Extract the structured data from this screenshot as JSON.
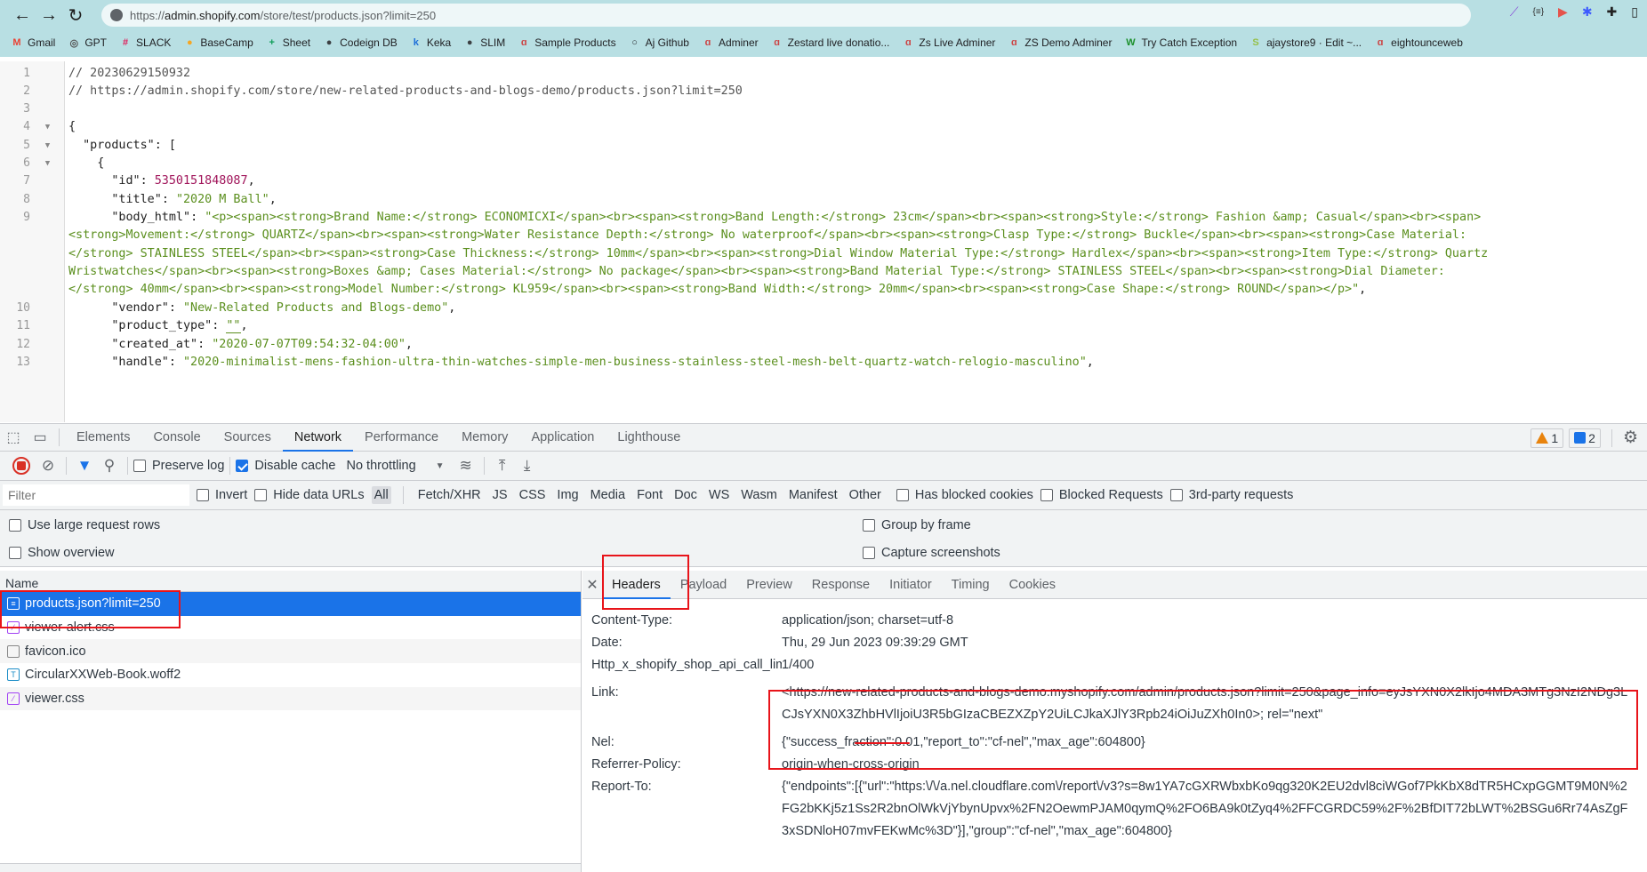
{
  "browser": {
    "url_prefix": "https://",
    "url_host": "admin.shopify.com",
    "url_path": "/store/test/products.json?limit=250",
    "bookmarks": [
      {
        "label": "Gmail",
        "icon": "gmail-icon",
        "glyph": "M",
        "color": "#ea4335"
      },
      {
        "label": "GPT",
        "icon": "chatgpt-icon",
        "glyph": "◎",
        "color": "#555555"
      },
      {
        "label": "SLACK",
        "icon": "slack-icon",
        "glyph": "#",
        "color": "#e01e5a"
      },
      {
        "label": "BaseCamp",
        "icon": "basecamp-icon",
        "glyph": "●",
        "color": "#f5a623"
      },
      {
        "label": "Sheet",
        "icon": "sheets-icon",
        "glyph": "+",
        "color": "#0f9d58"
      },
      {
        "label": "Codeign DB",
        "icon": "globe-icon",
        "glyph": "●",
        "color": "#3c4043"
      },
      {
        "label": "Keka",
        "icon": "keka-icon",
        "glyph": "k",
        "color": "#1e6fd9"
      },
      {
        "label": "SLIM",
        "icon": "globe-icon",
        "glyph": "●",
        "color": "#3c4043"
      },
      {
        "label": "Sample Products",
        "icon": "adminer-icon",
        "glyph": "ɑ",
        "color": "#c44"
      },
      {
        "label": "Aj Github",
        "icon": "github-icon",
        "glyph": "○",
        "color": "#24292e"
      },
      {
        "label": "Adminer",
        "icon": "adminer-icon",
        "glyph": "ɑ",
        "color": "#c44"
      },
      {
        "label": "Zestard live donatio...",
        "icon": "adminer-icon",
        "glyph": "ɑ",
        "color": "#c44"
      },
      {
        "label": "Zs Live Adminer",
        "icon": "adminer-icon",
        "glyph": "ɑ",
        "color": "#c44"
      },
      {
        "label": "ZS Demo Adminer",
        "icon": "adminer-icon",
        "glyph": "ɑ",
        "color": "#c44"
      },
      {
        "label": "Try Catch Exception",
        "icon": "w3-icon",
        "glyph": "W",
        "color": "#1a8f2a"
      },
      {
        "label": "ajaystore9 · Edit ~...",
        "icon": "shopify-icon",
        "glyph": "S",
        "color": "#95bf47"
      },
      {
        "label": "eightounceweb",
        "icon": "adminer-icon",
        "glyph": "ɑ",
        "color": "#c44"
      }
    ]
  },
  "code": {
    "lines": [
      {
        "n": "1",
        "html": "<span class='cmt'>// 20230629150932</span>"
      },
      {
        "n": "2",
        "html": "<span class='cmt'>// https://admin.shopify.com/store/new-related-products-and-blogs-demo/products.json?limit=250</span>"
      },
      {
        "n": "3",
        "html": ""
      },
      {
        "n": "4",
        "fold": true,
        "html": "{"
      },
      {
        "n": "5",
        "fold": true,
        "html": "  <span class='key'>\"products\"</span>: ["
      },
      {
        "n": "6",
        "fold": true,
        "html": "    {"
      },
      {
        "n": "7",
        "html": "      <span class='key'>\"id\"</span>: <span class='num'>5350151848087</span>,"
      },
      {
        "n": "8",
        "html": "      <span class='key'>\"title\"</span>: <span class='str'>\"2020 M Ball\"</span>,"
      },
      {
        "n": "9",
        "html": "      <span class='key'>\"body_html\"</span>: <span class='str'>\"&lt;p&gt;&lt;span&gt;&lt;strong&gt;Brand Name:&lt;/strong&gt; ECONOMICXI&lt;/span&gt;&lt;br&gt;&lt;span&gt;&lt;strong&gt;Band Length:&lt;/strong&gt; 23cm&lt;/span&gt;&lt;br&gt;&lt;span&gt;&lt;strong&gt;Style:&lt;/strong&gt; Fashion &amp;amp; Casual&lt;/span&gt;&lt;br&gt;&lt;span&gt;</span>"
      },
      {
        "n": "",
        "html": "<span class='str'>&lt;strong&gt;Movement:&lt;/strong&gt; QUARTZ&lt;/span&gt;&lt;br&gt;&lt;span&gt;&lt;strong&gt;Water Resistance Depth:&lt;/strong&gt; No waterproof&lt;/span&gt;&lt;br&gt;&lt;span&gt;&lt;strong&gt;Clasp Type:&lt;/strong&gt; Buckle&lt;/span&gt;&lt;br&gt;&lt;span&gt;&lt;strong&gt;Case Material:</span>"
      },
      {
        "n": "",
        "html": "<span class='str'>&lt;/strong&gt; STAINLESS STEEL&lt;/span&gt;&lt;br&gt;&lt;span&gt;&lt;strong&gt;Case Thickness:&lt;/strong&gt; 10mm&lt;/span&gt;&lt;br&gt;&lt;span&gt;&lt;strong&gt;Dial Window Material Type:&lt;/strong&gt; Hardlex&lt;/span&gt;&lt;br&gt;&lt;span&gt;&lt;strong&gt;Item Type:&lt;/strong&gt; Quartz</span>"
      },
      {
        "n": "",
        "html": "<span class='str'>Wristwatches&lt;/span&gt;&lt;br&gt;&lt;span&gt;&lt;strong&gt;Boxes &amp;amp; Cases Material:&lt;/strong&gt; No package&lt;/span&gt;&lt;br&gt;&lt;span&gt;&lt;strong&gt;Band Material Type:&lt;/strong&gt; STAINLESS STEEL&lt;/span&gt;&lt;br&gt;&lt;span&gt;&lt;strong&gt;Dial Diameter:</span>"
      },
      {
        "n": "",
        "html": "<span class='str'>&lt;/strong&gt; 40mm&lt;/span&gt;&lt;br&gt;&lt;span&gt;&lt;strong&gt;Model Number:&lt;/strong&gt; KL959&lt;/span&gt;&lt;br&gt;&lt;span&gt;&lt;strong&gt;Band Width:&lt;/strong&gt; 20mm&lt;/span&gt;&lt;br&gt;&lt;span&gt;&lt;strong&gt;Case Shape:&lt;/strong&gt; ROUND&lt;/span&gt;&lt;/p&gt;\"</span>,"
      },
      {
        "n": "10",
        "html": "      <span class='key'>\"vendor\"</span>: <span class='str'>\"New-Related Products and Blogs-demo\"</span>,"
      },
      {
        "n": "11",
        "html": "      <span class='key'>\"product_type\"</span>: <span class='empty-str'>\"\"</span>,"
      },
      {
        "n": "12",
        "html": "      <span class='key'>\"created_at\"</span>: <span class='str'>\"2020-07-07T09:54:32-04:00\"</span>,"
      },
      {
        "n": "13",
        "html": "      <span class='key'>\"handle\"</span>: <span class='str'>\"2020-minimalist-mens-fashion-ultra-thin-watches-simple-men-business-stainless-steel-mesh-belt-quartz-watch-relogio-masculino\"</span>,"
      }
    ]
  },
  "devtools": {
    "tabs": [
      "Elements",
      "Console",
      "Sources",
      "Network",
      "Performance",
      "Memory",
      "Application",
      "Lighthouse"
    ],
    "active_tab": "Network",
    "warnings_count": "1",
    "messages_count": "2",
    "toolbar": {
      "preserve_log": "Preserve log",
      "preserve_log_checked": false,
      "disable_cache": "Disable cache",
      "disable_cache_checked": true,
      "throttling": "No throttling"
    },
    "filter": {
      "placeholder": "Filter",
      "invert": "Invert",
      "hide_data_urls": "Hide data URLs",
      "types": [
        "All",
        "Fetch/XHR",
        "JS",
        "CSS",
        "Img",
        "Media",
        "Font",
        "Doc",
        "WS",
        "Wasm",
        "Manifest",
        "Other"
      ],
      "active_type": "All",
      "has_blocked_cookies": "Has blocked cookies",
      "blocked_requests": "Blocked Requests",
      "third_party": "3rd-party requests"
    },
    "settings": {
      "large_rows": "Use large request rows",
      "show_overview": "Show overview",
      "group_by_frame": "Group by frame",
      "capture_screenshots": "Capture screenshots"
    },
    "requests": {
      "column": "Name",
      "rows": [
        {
          "name": "products.json?limit=250",
          "type": "document",
          "selected": true
        },
        {
          "name": "viewer-alert.css",
          "type": "stylesheet",
          "selected": false
        },
        {
          "name": "favicon.ico",
          "type": "other",
          "selected": false
        },
        {
          "name": "CircularXXWeb-Book.woff2",
          "type": "font",
          "selected": false
        },
        {
          "name": "viewer.css",
          "type": "stylesheet",
          "selected": false
        }
      ]
    },
    "detail": {
      "tabs": [
        "Headers",
        "Payload",
        "Preview",
        "Response",
        "Initiator",
        "Timing",
        "Cookies"
      ],
      "active_tab": "Headers",
      "headers": [
        {
          "name": "Content-Type:",
          "value": "application/json; charset=utf-8"
        },
        {
          "name": "Date:",
          "value": "Thu, 29 Jun 2023 09:39:29 GMT"
        },
        {
          "name": "Http_x_shopify_shop_api_call_limit:",
          "value": "1/400"
        },
        {
          "name": "Link:",
          "value": "<https://new-related-products-and-blogs-demo.myshopify.com/admin/products.json?limit=250&page_info=eyJsYXN0X2lkIjo4MDA3MTg3NzI2NDg3LCJsYXN0X3ZhbHVlIjoiU3R5bGIzaCBEZXZpY2UiLCJkaXJlY3Rpb24iOiJuZXh0In0>; rel=\"next\""
        },
        {
          "name": "Nel:",
          "value": "{\"success_fraction\":0.01,\"report_to\":\"cf-nel\",\"max_age\":604800}"
        },
        {
          "name": "Referrer-Policy:",
          "value": "origin-when-cross-origin"
        },
        {
          "name": "Report-To:",
          "value": "{\"endpoints\":[{\"url\":\"https:\\/\\/a.nel.cloudflare.com\\/report\\/v3?s=8w1YA7cGXRWbxbKo9qg320K2EU2dvl8ciWGof7PkKbX8dTR5HCxpGGMT9M0N%2FG2bKKj5z1Ss2R2bnOlWkVjYbynUpvx%2FN2OewmPJAM0qymQ%2FO6BA9k0tZyq4%2FFCGRDC59%2F%2BfDIT72bLWT%2BSGu6Rr74AsZgF3xSDNloH07mvFEKwMc%3D\"}],\"group\":\"cf-nel\",\"max_age\":604800}"
        }
      ]
    }
  },
  "colors": {
    "accent": "#1a73e8",
    "annotation": "#e8141a",
    "string": "#5b8f1e",
    "number": "#a0145a"
  }
}
